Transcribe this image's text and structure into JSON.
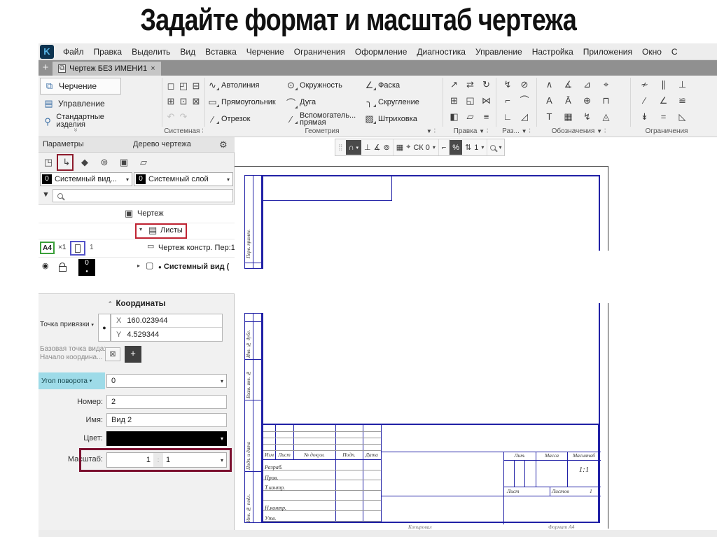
{
  "slide": {
    "title": "Задайте формат и масштаб чертежа"
  },
  "glyphs": {
    "gear": "⚙",
    "caret": "▼",
    "caret_s": "▾",
    "right": "▸",
    "down": "▾",
    "eye": "◉",
    "dot": "●",
    "funnel": "▼",
    "chev": "»",
    "box_x": "⊠",
    "move_pt": "+",
    "page": " ",
    "tree_doc": "▣",
    "folder": "▤",
    "sheet": "▭",
    "view": "▢",
    "grip": "⁞"
  },
  "menu": {
    "items": [
      "Файл",
      "Правка",
      "Выделить",
      "Вид",
      "Вставка",
      "Черчение",
      "Ограничения",
      "Оформление",
      "Диагностика",
      "Управление",
      "Настройка",
      "Приложения",
      "Окно",
      "С"
    ]
  },
  "tabbar": {
    "add": "+",
    "title": "Чертеж БЕЗ ИМЕНИ1",
    "close": "×",
    "doc_icon": "⧉"
  },
  "sidebar": {
    "items": [
      {
        "icon": "⧉",
        "label": "Черчение"
      },
      {
        "icon": "▤",
        "label": "Управление"
      },
      {
        "icon": "⚲",
        "label": "Стандартные изделия"
      }
    ],
    "collapse": "»"
  },
  "ribbon": {
    "system_icons": [
      "◻",
      "◰",
      "⊟",
      "⊞",
      "⊡",
      "⊠",
      "↶",
      "↷"
    ],
    "geometry_tools": [
      {
        "g": "∿",
        "label": "Автолиния"
      },
      {
        "g": "▭",
        "label": "Прямоугольник"
      },
      {
        "g": "∕",
        "label": "Отрезок"
      },
      {
        "g": "⊙",
        "label": "Окружность"
      },
      {
        "g": "⌒",
        "label": "Дуга"
      },
      {
        "g": "⁄",
        "label": "Вспомогатель... прямая"
      },
      {
        "g": "∠",
        "label": "Фаска"
      },
      {
        "g": "╮",
        "label": "Скругление"
      },
      {
        "g": "▨",
        "label": "Штриховка"
      }
    ],
    "edit_icons": [
      "↗",
      "⇄",
      "↻",
      "⊞",
      "◱",
      "⋈",
      "◧",
      "▱",
      "≡"
    ],
    "razm_icons": [
      "↯",
      "⊘",
      "⌐",
      "⌒",
      "∟",
      "◿"
    ],
    "oboz_icons": [
      "∧",
      "∡",
      "⊿",
      "⌖",
      "A",
      "Ā",
      "⊕",
      "⊓",
      "T",
      "▦",
      "↯",
      "◬"
    ],
    "constr_icons": [
      "≁",
      "∥",
      "⊥",
      "⁄",
      "∠",
      "≌",
      "↡",
      "=",
      "◺"
    ],
    "labels": {
      "system": "Системная",
      "geometry": "Геометрия",
      "edit": "Правка",
      "razm": "Раз...",
      "oboz": "Обозначения",
      "constr": "Ограничения"
    }
  },
  "panel": {
    "tabs": {
      "params": "Параметры",
      "tree": "Дерево чертежа"
    },
    "view_icons": [
      "◳",
      "↳",
      "◆",
      "⊜",
      "▣",
      "▱"
    ],
    "combo_view": {
      "badge": "0",
      "text": "Системный вид..."
    },
    "combo_layer": {
      "badge": "0",
      "text": "Системный слой"
    },
    "tree": {
      "root": "Чертеж",
      "sheets": "Листы",
      "sheet_item": "Чертеж констр. Пер:1",
      "view_item": "Системный вид (",
      "format": "A4",
      "mult": "×1",
      "num": "1",
      "layers_badge": "0"
    },
    "coords": {
      "header": "Координаты",
      "anchor_label": "Точка привязки",
      "x_label": "X",
      "x_value": "160.023944",
      "y_label": "Y",
      "y_value": "4.529344",
      "base_label1": "Базовая точка вида:",
      "base_label2": "Начало координа...",
      "angle_label": "Угол поворота",
      "angle_value": "0",
      "num_label": "Номер:",
      "num_value": "2",
      "name_label": "Имя:",
      "name_value": "Вид 2",
      "color_label": "Цвет:",
      "scale_label": "Масштаб:",
      "scale_v1": "1",
      "scale_sep": ":",
      "scale_v2": "1"
    }
  },
  "canvas": {
    "toolbar": {
      "grip": "⣿",
      "magnet": "∩",
      "snap1": "⊥",
      "snap2": "∡",
      "snap3": "⊚",
      "grid": "▦",
      "axes": "⌖",
      "sk": "СК 0",
      "corner": "⌐",
      "ortho": "%",
      "step_icon": "⇅",
      "step": "1"
    },
    "strips": {
      "top": "Перв. примен.",
      "cells": [
        "Инв. № дубл.",
        "Взам. инв. №",
        "Подп. и дата",
        "Инв. № подл."
      ]
    },
    "titleblock": {
      "cols": [
        "Изм",
        "Лист",
        "№ докум.",
        "Подп.",
        "Дата"
      ],
      "rows": [
        "Разраб.",
        "Пров.",
        "Т.контр.",
        "",
        "Н.контр.",
        "Утв."
      ],
      "lit": "Лит.",
      "mass": "Масса",
      "scale": "Масштаб",
      "scale_value": "1:1",
      "sheet": "Лист",
      "sheets": "Листов",
      "sheets_value": "1",
      "copied": "Копировал",
      "format": "Формат  А4"
    }
  }
}
